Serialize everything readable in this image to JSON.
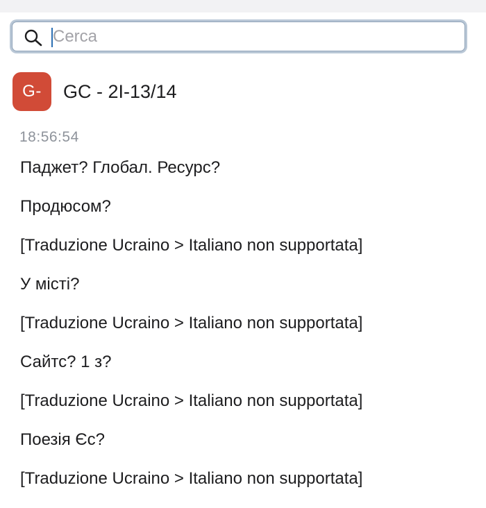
{
  "search": {
    "placeholder": "Cerca",
    "value": ""
  },
  "chat": {
    "avatar_initials": "G-",
    "avatar_color": "#d14b37",
    "title": "GC - 2I-13/14",
    "timestamp": "18:56:54",
    "messages": [
      "Паджет? Глобал. Ресурс?",
      "Продюсом?",
      "[Traduzione Ucraino > Italiano non supportata]",
      "У місті?",
      "[Traduzione Ucraino > Italiano non supportata]",
      "Сайтс? 1 з?",
      "[Traduzione Ucraino > Italiano non supportata]",
      "Поезія Єс?",
      "[Traduzione Ucraino > Italiano non supportata]"
    ]
  }
}
